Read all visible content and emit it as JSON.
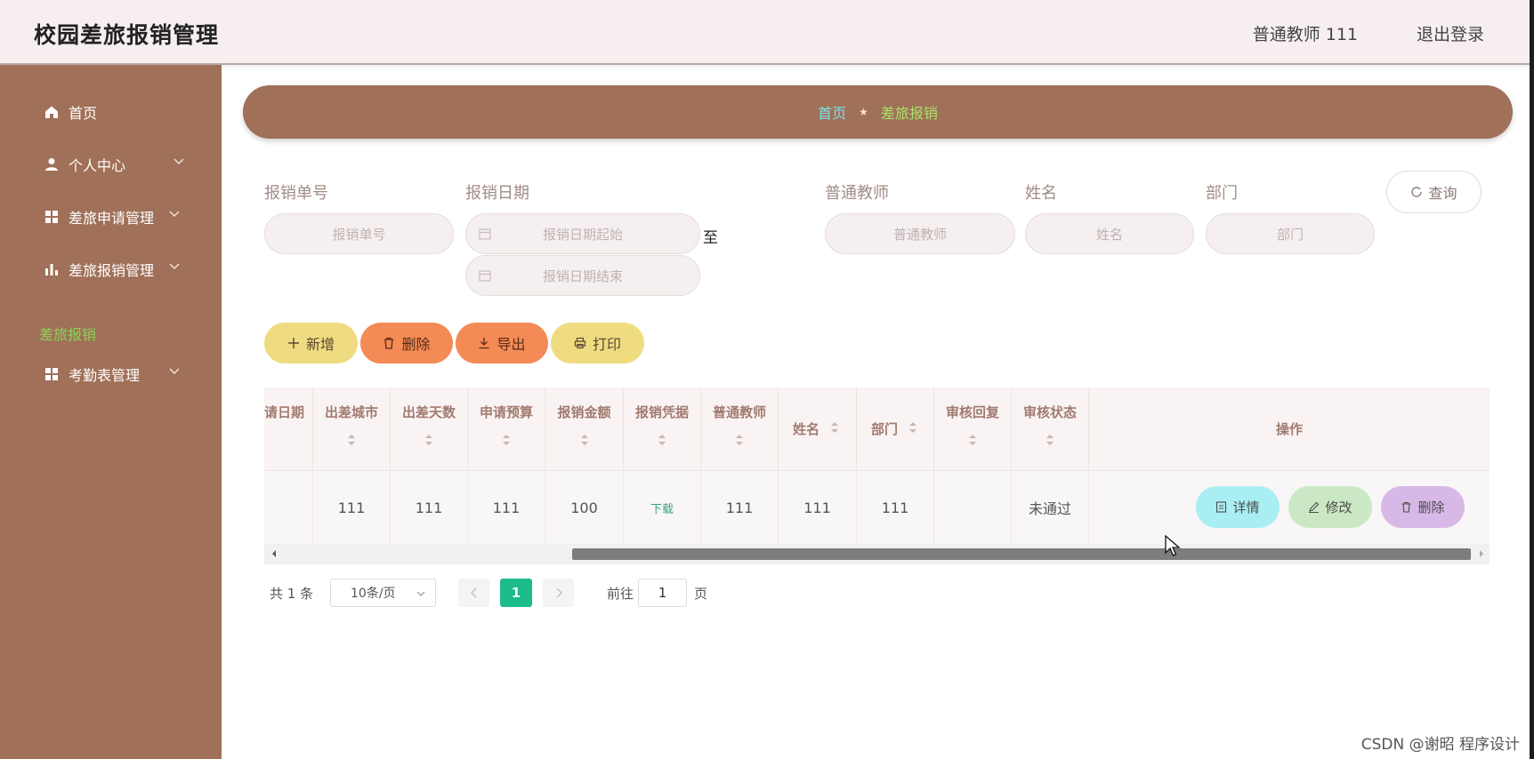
{
  "header": {
    "app_title": "校园差旅报销管理",
    "user_label": "普通教师 111",
    "logout_label": "退出登录"
  },
  "sidebar": {
    "items": [
      {
        "label": "首页",
        "icon": "home-icon"
      },
      {
        "label": "个人中心",
        "icon": "user-icon"
      },
      {
        "label": "差旅申请管理",
        "icon": "grid-icon"
      },
      {
        "label": "差旅报销管理",
        "icon": "bar-chart-icon"
      },
      {
        "label": "考勤表管理",
        "icon": "grid-icon"
      }
    ],
    "active_sub": "差旅报销"
  },
  "breadcrumb": {
    "home": "首页",
    "current": "差旅报销"
  },
  "filters": {
    "order_no_label": "报销单号",
    "order_no_placeholder": "报销单号",
    "date_label": "报销日期",
    "date_start_placeholder": "报销日期起始",
    "date_end_placeholder": "报销日期结束",
    "to_label": "至",
    "teacher_label": "普通教师",
    "teacher_placeholder": "普通教师",
    "name_label": "姓名",
    "name_placeholder": "姓名",
    "dept_label": "部门",
    "dept_placeholder": "部门",
    "query_label": "查询"
  },
  "actions": {
    "add": "新增",
    "delete": "删除",
    "export": "导出",
    "print": "打印"
  },
  "table": {
    "columns": [
      "请日期",
      "出差城市",
      "出差天数",
      "申请预算",
      "报销金额",
      "报销凭据",
      "普通教师",
      "姓名",
      "部门",
      "审核回复",
      "审核状态",
      "操作"
    ],
    "rows": [
      {
        "date": "",
        "city": "111",
        "days": "111",
        "budget": "111",
        "amount": "100",
        "proof": "下载",
        "teacher": "111",
        "name": "111",
        "dept": "111",
        "reply": "",
        "status": "未通过"
      }
    ],
    "row_actions": {
      "detail": "详情",
      "edit": "修改",
      "delete": "删除"
    }
  },
  "pagination": {
    "total": "共 1 条",
    "page_size": "10条/页",
    "current_page": "1",
    "goto_label": "前往",
    "goto_value": "1",
    "page_suffix": "页"
  },
  "watermark": "CSDN @谢昭 程序设计",
  "colors": {
    "sidebar_bg": "#a07058",
    "header_bg": "#f7eef0",
    "active_green": "#8dd05a",
    "pager_active": "#1cbb8c"
  }
}
